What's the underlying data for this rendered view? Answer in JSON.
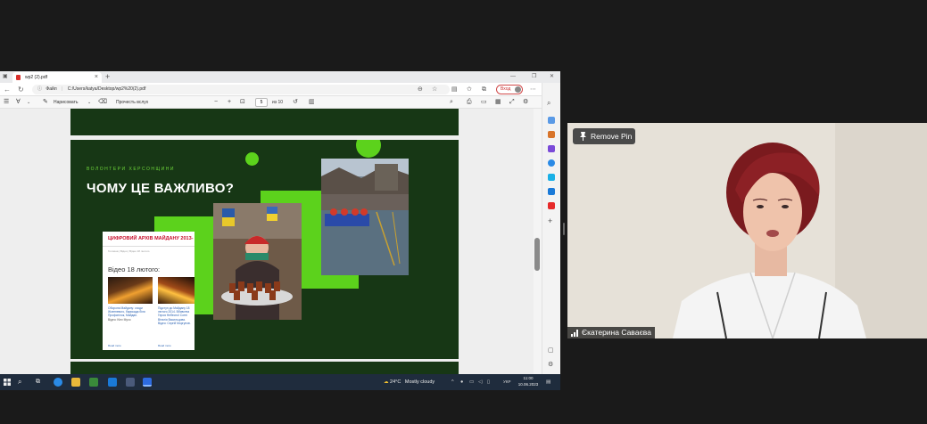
{
  "browser": {
    "tab_title": "wp2 (2).pdf",
    "new_tab": "+",
    "address_label": "Файл",
    "address_path": "C:/Users/katya/Desktop/wp2%20(2).pdf",
    "signin_label": "Вход"
  },
  "pdf_toolbar": {
    "draw_label": "Нарисовать",
    "read_aloud_label": "Прочесть вслух",
    "page_current": "5",
    "page_total": "из 10"
  },
  "slide": {
    "subtitle": "ВОЛОНТЕРИ ХЕРСОНЩИНИ",
    "title": "ЧОМУ ЦЕ ВАЖЛИВО?",
    "archive": {
      "header": "ЦИФРОВИЙ АРХІВ МАЙДАНУ 2013-",
      "breadcrumb": "Головна | Відео | Відео 18 лютого",
      "video_title": "Відео 18 лютого:",
      "caption1": "Оборона Майдану: сходи Жовтневого, барикада біля Профспілок, Майдан.",
      "caption1_meta": "Відео: Kiev Myxo",
      "caption2": "Підступ до Майдану 18 лютого 2014. Вбивства Героя Небесної Сотні Віталія Васильцова. Відео: Сергій Моргунов.",
      "read_more": "Read more"
    }
  },
  "taskbar": {
    "temperature": "24°C",
    "weather": "Mostly cloudy",
    "language": "УКР",
    "time": "11:00",
    "date": "10.06.2023"
  },
  "video": {
    "remove_pin_label": "Remove Pin",
    "participant_name": "Єкатерина Саваєва"
  },
  "colors": {
    "slide_bg": "#173715",
    "accent_green": "#5cd21c",
    "archive_red": "#c8102e",
    "taskbar_bg": "#1f2c3d"
  }
}
